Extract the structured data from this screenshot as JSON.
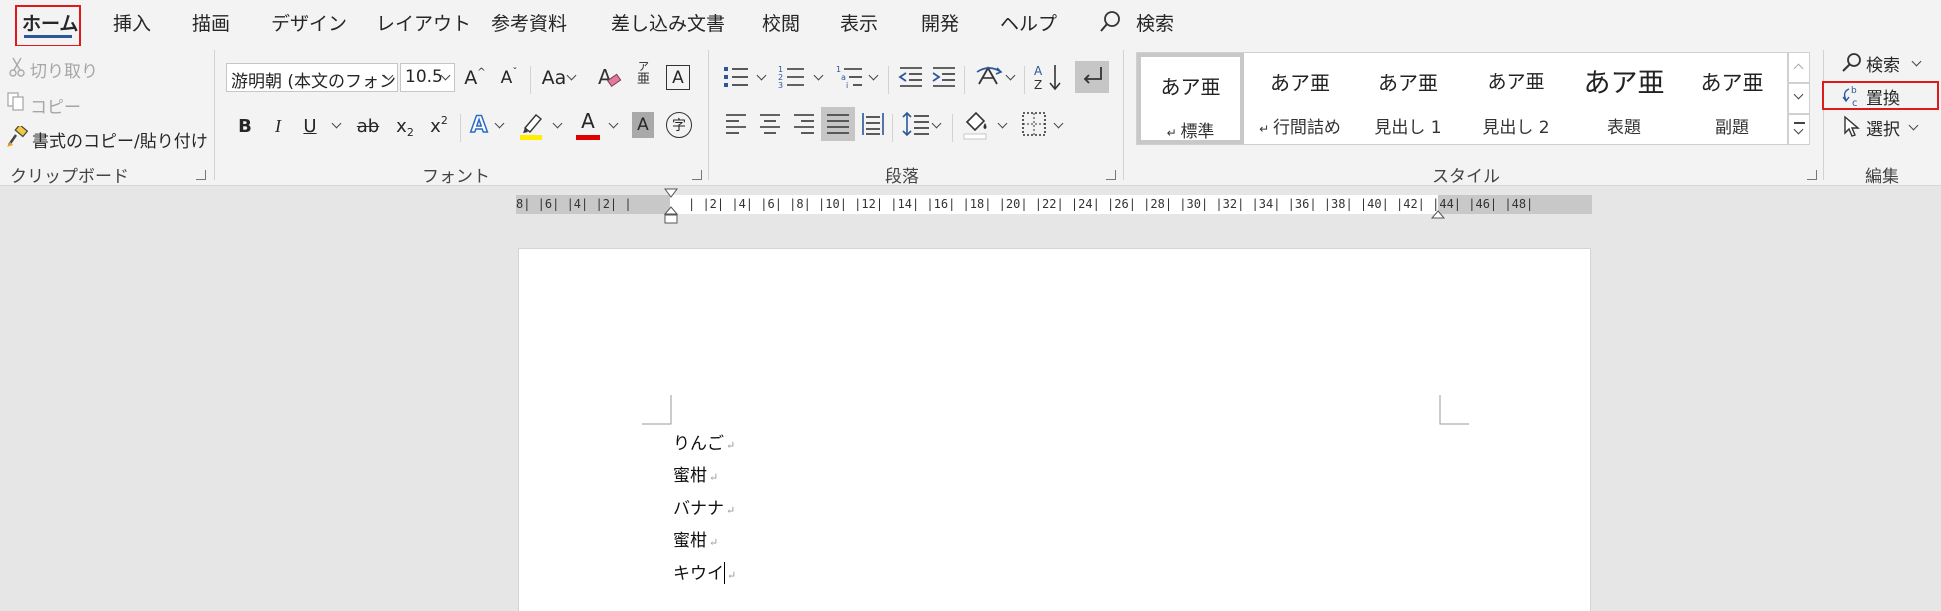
{
  "tabs": [
    "ホーム",
    "挿入",
    "描画",
    "デザイン",
    "レイアウト",
    "参考資料",
    "差し込み文書",
    "校閲",
    "表示",
    "開発",
    "ヘルプ"
  ],
  "search_tab": "検索",
  "clipboard": {
    "cut": "切り取り",
    "copy": "コピー",
    "format_painter": "書式のコピー/貼り付け",
    "label": "クリップボード"
  },
  "font": {
    "name": "游明朝 (本文のフォント",
    "size": "10.5",
    "label": "フォント",
    "change_case": "Aa",
    "phonetic_top": "ア",
    "phonetic_bottom": "亜",
    "bold": "B",
    "italic": "I",
    "underline": "U",
    "strike": "ab",
    "subscript": "x",
    "sub2": "2",
    "superscript": "x",
    "sup2": "2",
    "grow": "A",
    "shrink": "A",
    "text_effects": "A",
    "font_color": "A",
    "shading": "A",
    "enclose": "字",
    "border_char": "A",
    "highlight_color": "#ffff00",
    "font_color_value": "#e00000"
  },
  "paragraph": {
    "label": "段落"
  },
  "styles": {
    "label": "スタイル",
    "items": [
      {
        "sample": "あア亜",
        "name": "標準"
      },
      {
        "sample": "あア亜",
        "name": "行間詰め"
      },
      {
        "sample": "あア亜",
        "name": "見出し 1"
      },
      {
        "sample": "あア亜",
        "name": "見出し 2"
      },
      {
        "sample": "あア亜",
        "name": "表題"
      },
      {
        "sample": "あア亜",
        "name": "副題"
      }
    ]
  },
  "editing": {
    "find": "検索",
    "replace": "置換",
    "select": "選択",
    "label": "編集"
  },
  "ruler": {
    "left_numbers": "8| |6| |4| |2| |",
    "right_numbers": "| |2| |4| |6| |8| |10| |12| |14| |16| |18| |20| |22| |24| |26| |28| |30| |32| |34| |36| |38| |40| |42| |44| |46| |48|"
  },
  "document": {
    "lines": [
      "りんご",
      "蜜柑",
      "バナナ",
      "蜜柑",
      "キウイ"
    ],
    "para_mark": "↵"
  }
}
